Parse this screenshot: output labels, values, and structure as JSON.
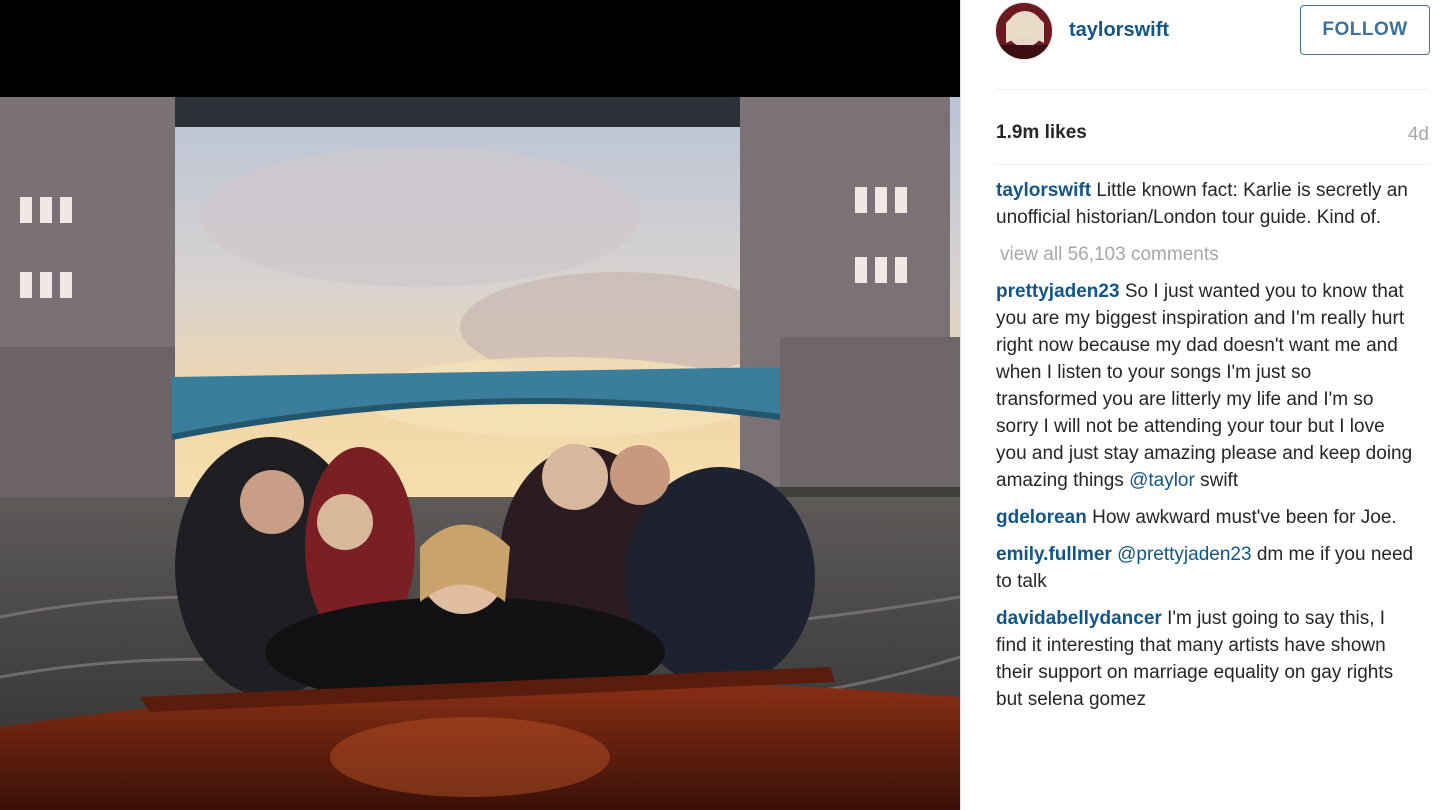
{
  "post": {
    "username": "taylorswift",
    "follow_label": "FOLLOW",
    "likes": "1.9m likes",
    "age": "4d",
    "view_all_comments": "view all 56,103 comments"
  },
  "caption": {
    "user": "taylorswift",
    "text": "Little known fact: Karlie is secretly an unofficial historian/London tour guide. Kind of."
  },
  "comments": [
    {
      "user": "prettyjaden23",
      "text": "So I just wanted you to know that you are my biggest inspiration and I'm really hurt right now because my dad doesn't want me and when I listen to your songs I'm just so transformed you are litterly my life and I'm so sorry I will not be attending your tour but I love you and just stay amazing please and keep doing amazing things",
      "mention": "@taylor",
      "tail": "swift"
    },
    {
      "user": "gdelorean",
      "text": "How awkward must've been for Joe."
    },
    {
      "user": "emily.fullmer",
      "mention": "@prettyjaden23",
      "text": "dm me if you need to talk"
    },
    {
      "user": "davidabellydancer",
      "text": "I'm just going to say this, I find it interesting that many artists have shown their support on marriage equality on gay rights but selena gomez"
    }
  ],
  "colors": {
    "link": "#125688",
    "follow": "#3f729b",
    "muted": "#a5a7aa",
    "text": "#262626"
  }
}
